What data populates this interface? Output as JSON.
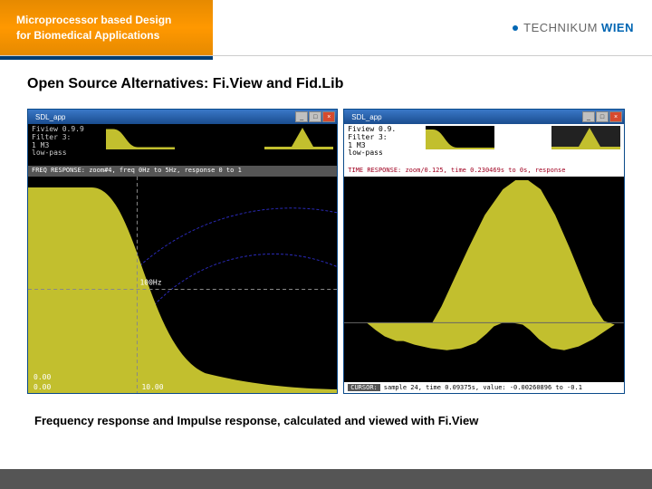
{
  "header": {
    "title_line1": "Microprocessor based Design",
    "title_line2": "for Biomedical Applications",
    "logo_text1": "TECHNIKUM",
    "logo_text2": "WIEN"
  },
  "slide": {
    "title": "Open Source Alternatives: Fi.View and Fid.Lib",
    "caption": "Frequency response and Impulse response, calculated and viewed with Fi.View"
  },
  "windows": {
    "left": {
      "titlebar": "SDL_app",
      "info": {
        "line1": "Fiview 0.9.9",
        "line2": "Filter 3:",
        "line3": " 1 M3",
        "line4": "low-pass"
      },
      "status": "FREQ RESPONSE: zoom#4, freq 0Hz to 5Hz, response 0 to 1",
      "axis": {
        "y": "0.00",
        "x1": "0.00",
        "x2": "10.00"
      }
    },
    "right": {
      "titlebar": "SDL_app",
      "info": {
        "line1": "Fiview 0.9.",
        "line2": "Filter 3:",
        "line3": " 1 M3",
        "line4": " low-pass"
      },
      "status": "TIME RESPONSE: zoom/0.125, time 0.230469s to 0s, response",
      "cursor_label": "CURSOR:",
      "cursor_text": "sample 24, time 0.09375s, value: -0.00260896 to -0.1"
    }
  },
  "colors": {
    "accent": "#ff9800",
    "plot_fill": "#c2bf2e",
    "plot_bg": "#000000",
    "guide": "#3a3ad0"
  }
}
